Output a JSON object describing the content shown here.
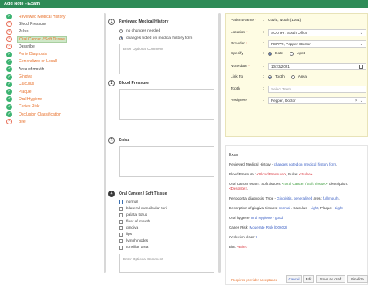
{
  "window": {
    "title": "Add Note - Exam"
  },
  "sidebar": {
    "items": [
      {
        "label": "Reviewed Medical History",
        "status": "check",
        "tone": "orange"
      },
      {
        "label": "Blood Pressure",
        "status": "x",
        "tone": "dark"
      },
      {
        "label": "Pulse",
        "status": "x",
        "tone": "dark"
      },
      {
        "label": "Oral Cancer / Soft Tissue",
        "status": "x",
        "tone": "active"
      },
      {
        "label": "Describe",
        "status": "x",
        "tone": "dark"
      },
      {
        "label": "Perio Diagnosis",
        "status": "check",
        "tone": "orange"
      },
      {
        "label": "Generalized or Locall",
        "status": "check",
        "tone": "orange"
      },
      {
        "label": "Area of mouth",
        "status": "check",
        "tone": "dark"
      },
      {
        "label": "Gingiva",
        "status": "check",
        "tone": "orange"
      },
      {
        "label": "Calculus",
        "status": "check",
        "tone": "orange"
      },
      {
        "label": "Plaque",
        "status": "check",
        "tone": "orange"
      },
      {
        "label": "Oral Hygiene",
        "status": "check",
        "tone": "orange"
      },
      {
        "label": "Caries Risk",
        "status": "check",
        "tone": "orange"
      },
      {
        "label": "Occlusion Classification",
        "status": "check",
        "tone": "orange"
      },
      {
        "label": "Bite",
        "status": "x",
        "tone": "orange"
      }
    ]
  },
  "form": {
    "s1": {
      "num": "1",
      "title": "Reviewed Medical History",
      "opt1": "no changes needed",
      "opt2": "changes noted on medical history form",
      "comment_placeholder": "Enter Optional Comment"
    },
    "s2": {
      "num": "2",
      "title": "Blood Pressure"
    },
    "s3": {
      "num": "3",
      "title": "Pulse"
    },
    "s4": {
      "num": "4",
      "title": "Oral Cancer / Soft Tissue",
      "options": [
        "normal",
        "bilateral mandibular tori",
        "palatal torus",
        "floor of mouth",
        "gingiva",
        "lips",
        "lymph nodes",
        "tonsillar area"
      ],
      "comment_placeholder": "Enter Optional Comment"
    }
  },
  "patient": {
    "name_label": "Patient Name",
    "name_value": "Covitt, Noah (1161)",
    "location_label": "Location",
    "location_value": "SOUTH : South Office",
    "provider_label": "Provider",
    "provider_value": "PEPPR, Pepper, Doctor",
    "specify_label": "Specify",
    "specify_opt1": "Date",
    "specify_opt2": "Appt",
    "notedate_label": "Note date",
    "notedate_value": "10/23/2021",
    "linkto_label": "Link To",
    "linkto_opt1": "Tooth",
    "linkto_opt2": "Area",
    "tooth_label": "Tooth",
    "tooth_placeholder": "Select Teeth",
    "assignee_label": "Assignee",
    "assignee_value": "Pepper, Doctor"
  },
  "summary": {
    "heading": "Exam",
    "l1_prefix": "Reviewed Medical History - ",
    "l1_value": "changes noted on medical history form",
    "l1_suffix": ".",
    "l2_prefix": "Blood Pressure : ",
    "l2_value": "<Blood Pressure>",
    "l2_mid": ", Pulse: ",
    "l2_value2": "<Pulse>",
    "l3_prefix": "Oral Cancer exam / Soft tissues: ",
    "l3_value": "<Oral Cancer / Soft Tissue>",
    "l3_mid": ", description: ",
    "l3_value2": "<Describe>",
    "l3_suffix": ".",
    "l4_prefix": "Periodontal diagnosis: Type - ",
    "l4_value": "Gingivitis",
    "l4_mid": ", ",
    "l4_value2": "generalized",
    "l4_mid2": " area: ",
    "l4_value3": "full mouth",
    "l4_suffix": ".",
    "l5_prefix": "Description of gingival tissues: ",
    "l5_value": "normal",
    "l5_mid": " . Calculus - ",
    "l5_value2": "Light",
    "l5_mid2": ", Plaque - ",
    "l5_value3": "Light",
    "l6_prefix": "Oral hygiene ",
    "l6_value": "Oral Hygiene - good",
    "l7_prefix": "Caries Risk: ",
    "l7_value": "Moderate Risk (D0602)",
    "l8_prefix": "Occlusion class: ",
    "l8_value": "I",
    "l9_prefix": "Bite: ",
    "l9_value": "<Bite>"
  },
  "footer": {
    "note": "Requires provider acceptance",
    "cancel": "Cancel",
    "edit": "Edit",
    "save_draft": "Save as draft",
    "finalize": "Finalize"
  },
  "colors": {
    "title_bar": "#2e8b57",
    "check": "#3cb371",
    "accent_orange": "#e8702a",
    "header_box": "#fefce3"
  }
}
